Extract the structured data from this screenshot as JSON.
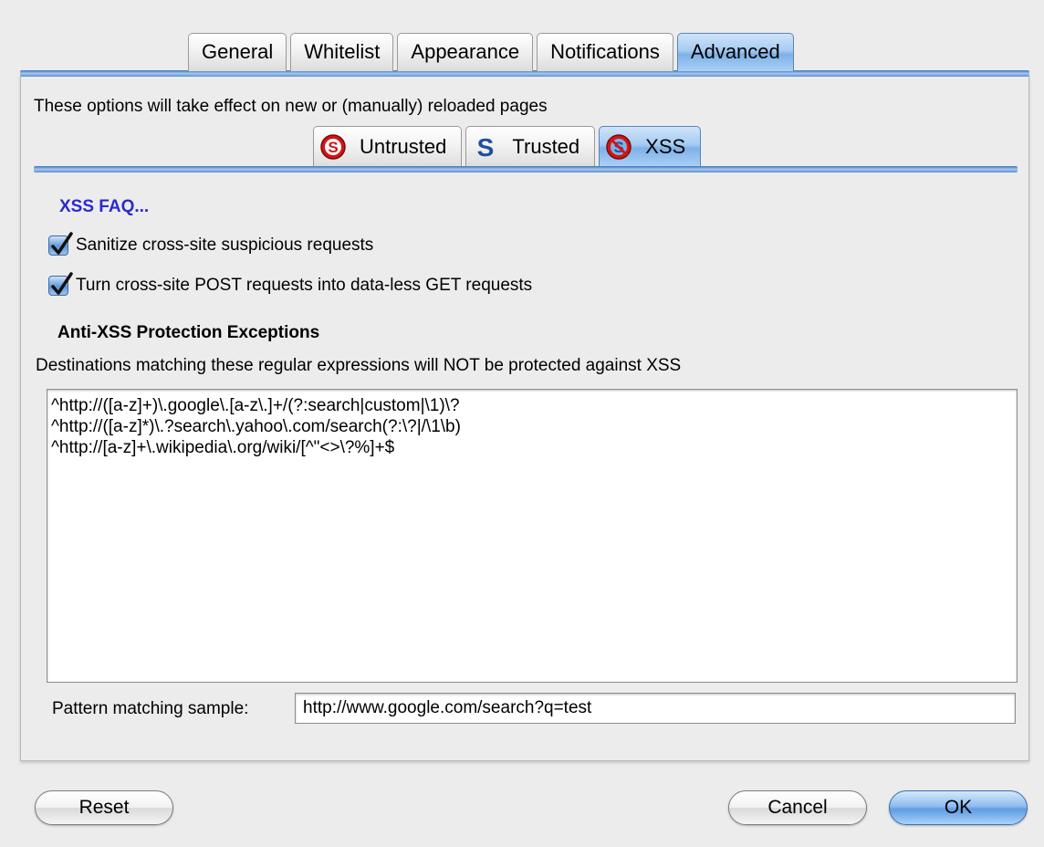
{
  "top_tabs": {
    "general": "General",
    "whitelist": "Whitelist",
    "appearance": "Appearance",
    "notifications": "Notifications",
    "advanced": "Advanced",
    "selected": "Advanced"
  },
  "notice": "These options will take effect on new or (manually) reloaded pages",
  "sub_tabs": {
    "untrusted": "Untrusted",
    "trusted": "Trusted",
    "xss": "XSS",
    "selected": "XSS"
  },
  "xss": {
    "faq_link": "XSS FAQ...",
    "sanitize_label": "Sanitize cross-site suspicious requests",
    "sanitize_checked": true,
    "post_label": "Turn cross-site POST requests into data-less GET requests",
    "post_checked": true,
    "exceptions_title": "Anti-XSS Protection Exceptions",
    "exceptions_desc": "Destinations matching these regular expressions will NOT be protected against XSS",
    "exceptions_text": "^http://([a-z]+)\\.google\\.[a-z\\.]+/(?:search|custom|\\1)\\?\n^http://([a-z]*)\\.?search\\.yahoo\\.com/search(?:\\?|/\\1\\b)\n^http://[a-z]+\\.wikipedia\\.org/wiki/[^\"<>\\?%]+$",
    "sample_label": "Pattern matching sample:",
    "sample_value": "http://www.google.com/search?q=test"
  },
  "buttons": {
    "reset": "Reset",
    "cancel": "Cancel",
    "ok": "OK"
  },
  "icons": {
    "untrusted": "noscript-red-s-icon",
    "trusted": "noscript-blue-s-icon",
    "xss": "noscript-xss-icon"
  },
  "colors": {
    "accent": "#6ea6e4",
    "link": "#2a2ad0",
    "untrusted_icon": "#d41414",
    "trusted_icon": "#1f4f9c"
  }
}
